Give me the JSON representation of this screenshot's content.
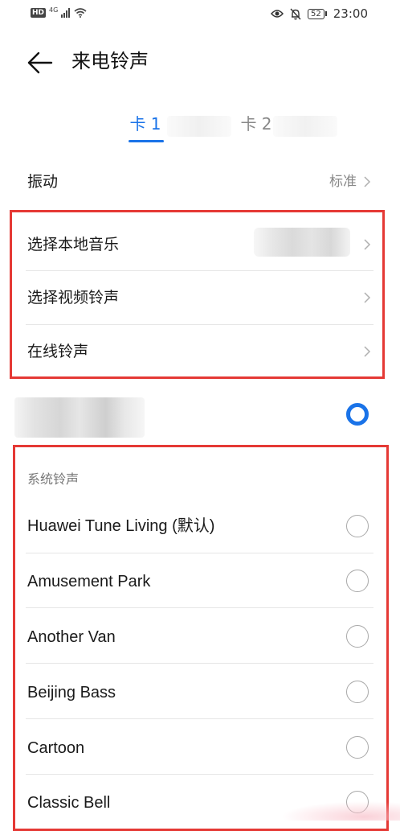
{
  "status_bar": {
    "hd": "HD",
    "network": "4G",
    "battery": "52",
    "time": "23:00"
  },
  "header": {
    "title": "来电铃声"
  },
  "tabs": [
    {
      "label": "卡 1",
      "selected": true
    },
    {
      "label": "卡 2",
      "selected": false
    }
  ],
  "vibration": {
    "label": "振动",
    "value": "标准"
  },
  "sources": [
    {
      "label": "选择本地音乐"
    },
    {
      "label": "选择视频铃声"
    },
    {
      "label": "在线铃声"
    }
  ],
  "current_ringtone": {
    "selected": true
  },
  "system_ringtones": {
    "section_title": "系统铃声",
    "items": [
      {
        "label": "Huawei Tune Living (默认)",
        "selected": false
      },
      {
        "label": "Amusement Park",
        "selected": false
      },
      {
        "label": "Another Van",
        "selected": false
      },
      {
        "label": "Beijing Bass",
        "selected": false
      },
      {
        "label": "Cartoon",
        "selected": false
      },
      {
        "label": "Classic Bell",
        "selected": false
      }
    ]
  },
  "colors": {
    "accent": "#1a73e8",
    "highlight_border": "#e53935"
  },
  "icons": [
    "back-arrow-icon",
    "chevron-right-icon",
    "eye-icon",
    "mute-bell-icon",
    "signal-icon",
    "wifi-icon",
    "battery-icon"
  ]
}
